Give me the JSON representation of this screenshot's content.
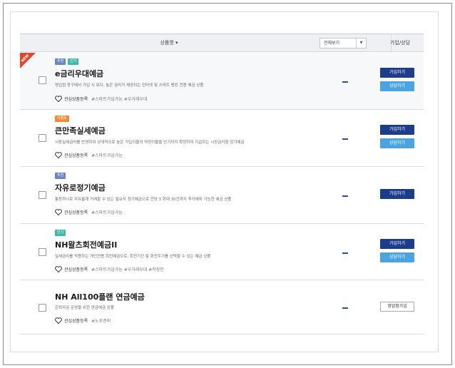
{
  "header": {
    "product_name_label": "상품명 ▾",
    "filter_select_value": "전체보기",
    "join_consult_label": "가입/상담"
  },
  "products": [
    {
      "ribbon": "NEW",
      "badges": [
        "추천",
        "인기"
      ],
      "title": "e금리우대예금",
      "desc": "영업점 창구에서 가입 시 보다, 높은 금리가 제공되는 인터넷 및 스마트 뱅킹 전용 예금 상품",
      "interest_label": "관심상품등록",
      "tags": "#스마트가입가능 #우거래우대",
      "rate": "-",
      "join_label": "가입하기",
      "consult_label": "상담하기"
    },
    {
      "badges": [
        "이벤트"
      ],
      "title": "큰만족실세예금",
      "desc": "시장실세금리를 반영하여 상대적으로 높은 가입이율의 약정이율을 단기까지 확정하여 지급하는 시장금리형 정기예금",
      "interest_label": "관심상품등록",
      "tags": "#스마트가입가능",
      "rate": "-",
      "join_label": "가입하기",
      "consult_label": "상담하기"
    },
    {
      "badges": [
        "추천"
      ],
      "title": "자유로정기예금",
      "desc": "통장하나로 자유롭게 거래할 수 있는 필요식 정기예금으로 건당 3 회대 30건까지 추가예치 가능한 예금 상품",
      "interest_label": "관심상품등록",
      "tags": "#스마트가입가능",
      "rate": "-",
      "join_label": "가입하기"
    },
    {
      "badges": [
        "인기"
      ],
      "title": "NH왈츠회전예금II",
      "desc": "실세금리를 적용하는 개인전용 회전예금으로, 회전기간 및 회전주기를 선택할 수 있는 예금 상품",
      "interest_label": "관심상품등록",
      "tags": "#스마트가입가능 #우거래우대 #직장인",
      "rate": "-",
      "join_label": "가입하기",
      "consult_label": "상담하기"
    },
    {
      "badges": [],
      "title": "NH All100플랜 연금예금",
      "desc": "은퇴자금 운영을 위한 연금예금 상품",
      "interest_label": "관심상품등록",
      "tags": "#노후준비",
      "rate": "-",
      "branch_label": "영업점가입"
    }
  ],
  "colors": {
    "join_button": "#1e3c8c",
    "consult_button": "#4ba4e0",
    "badge_recommend": "#6b86c4",
    "badge_popular": "#3fb8a9",
    "badge_event": "#f0893a",
    "ribbon_new": "#e0452f"
  }
}
